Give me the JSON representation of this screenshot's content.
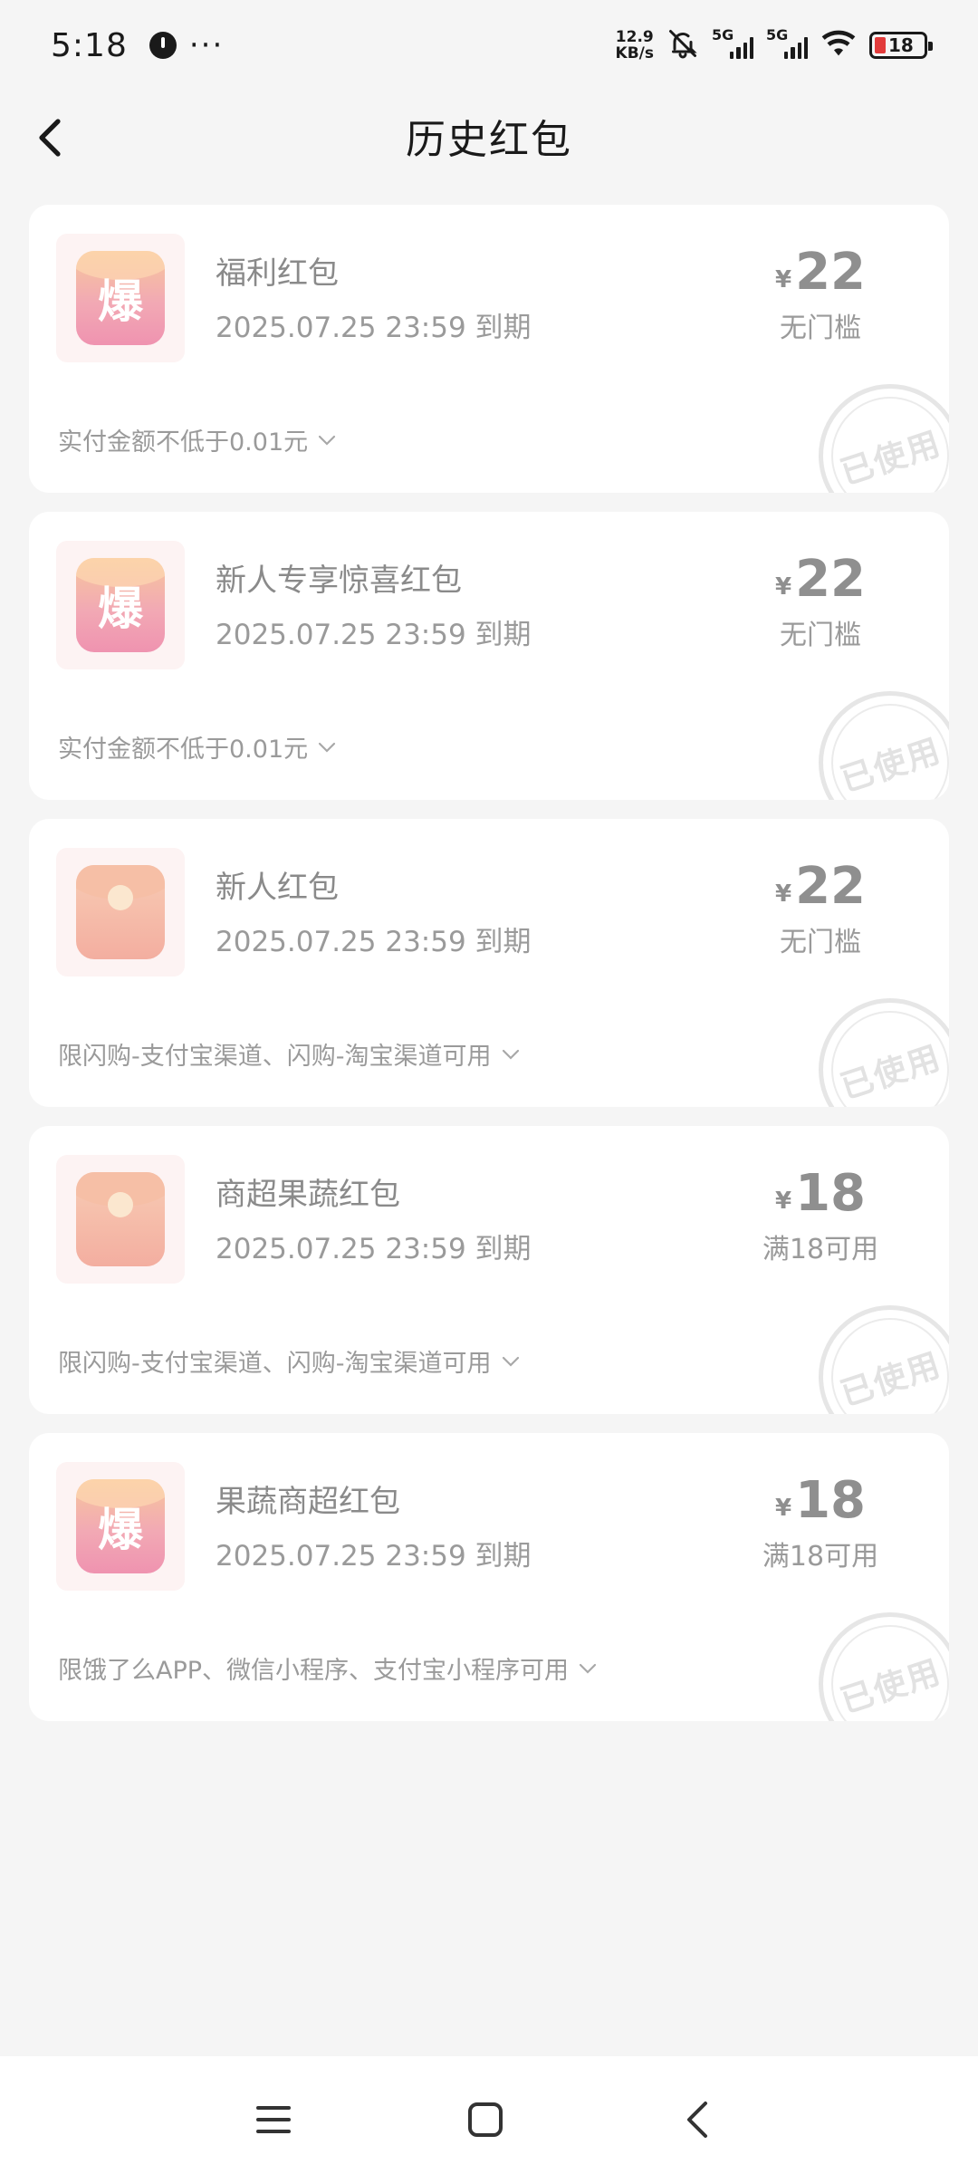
{
  "status_bar": {
    "time": "5:18",
    "more": "···",
    "netspeed_value": "12.9",
    "netspeed_unit": "KB/s",
    "signal1_label": "5G",
    "signal2_label": "5G",
    "battery": "18",
    "icons": [
      "watch-icon",
      "mute-bell-icon",
      "signal-icon",
      "wifi-icon",
      "battery-icon"
    ]
  },
  "header": {
    "title": "历史红包",
    "back_icon": "chevron-left-icon"
  },
  "coupons": [
    {
      "icon": "bao-envelope",
      "icon_text": "爆",
      "title": "福利红包",
      "expire": "2025.07.25 23:59 到期",
      "currency": "¥",
      "amount": "22",
      "condition": "无门槛",
      "rule": "实付金额不低于0.01元",
      "stamp": "已使用"
    },
    {
      "icon": "bao-envelope",
      "icon_text": "爆",
      "title": "新人专享惊喜红包",
      "expire": "2025.07.25 23:59 到期",
      "currency": "¥",
      "amount": "22",
      "condition": "无门槛",
      "rule": "实付金额不低于0.01元",
      "stamp": "已使用"
    },
    {
      "icon": "red-envelope",
      "title": "新人红包",
      "expire": "2025.07.25 23:59 到期",
      "currency": "¥",
      "amount": "22",
      "condition": "无门槛",
      "rule": "限闪购-支付宝渠道、闪购-淘宝渠道可用",
      "stamp": "已使用"
    },
    {
      "icon": "red-envelope",
      "title": "商超果蔬红包",
      "expire": "2025.07.25 23:59 到期",
      "currency": "¥",
      "amount": "18",
      "condition": "满18可用",
      "rule": "限闪购-支付宝渠道、闪购-淘宝渠道可用",
      "stamp": "已使用"
    },
    {
      "icon": "bao-envelope",
      "icon_text": "爆",
      "title": "果蔬商超红包",
      "expire": "2025.07.25 23:59 到期",
      "currency": "¥",
      "amount": "18",
      "condition": "满18可用",
      "rule": "限饿了么APP、微信小程序、支付宝小程序可用",
      "stamp": "已使用"
    }
  ],
  "nav_bar": {
    "icons": [
      "menu-icon",
      "home-icon",
      "back-icon"
    ]
  }
}
